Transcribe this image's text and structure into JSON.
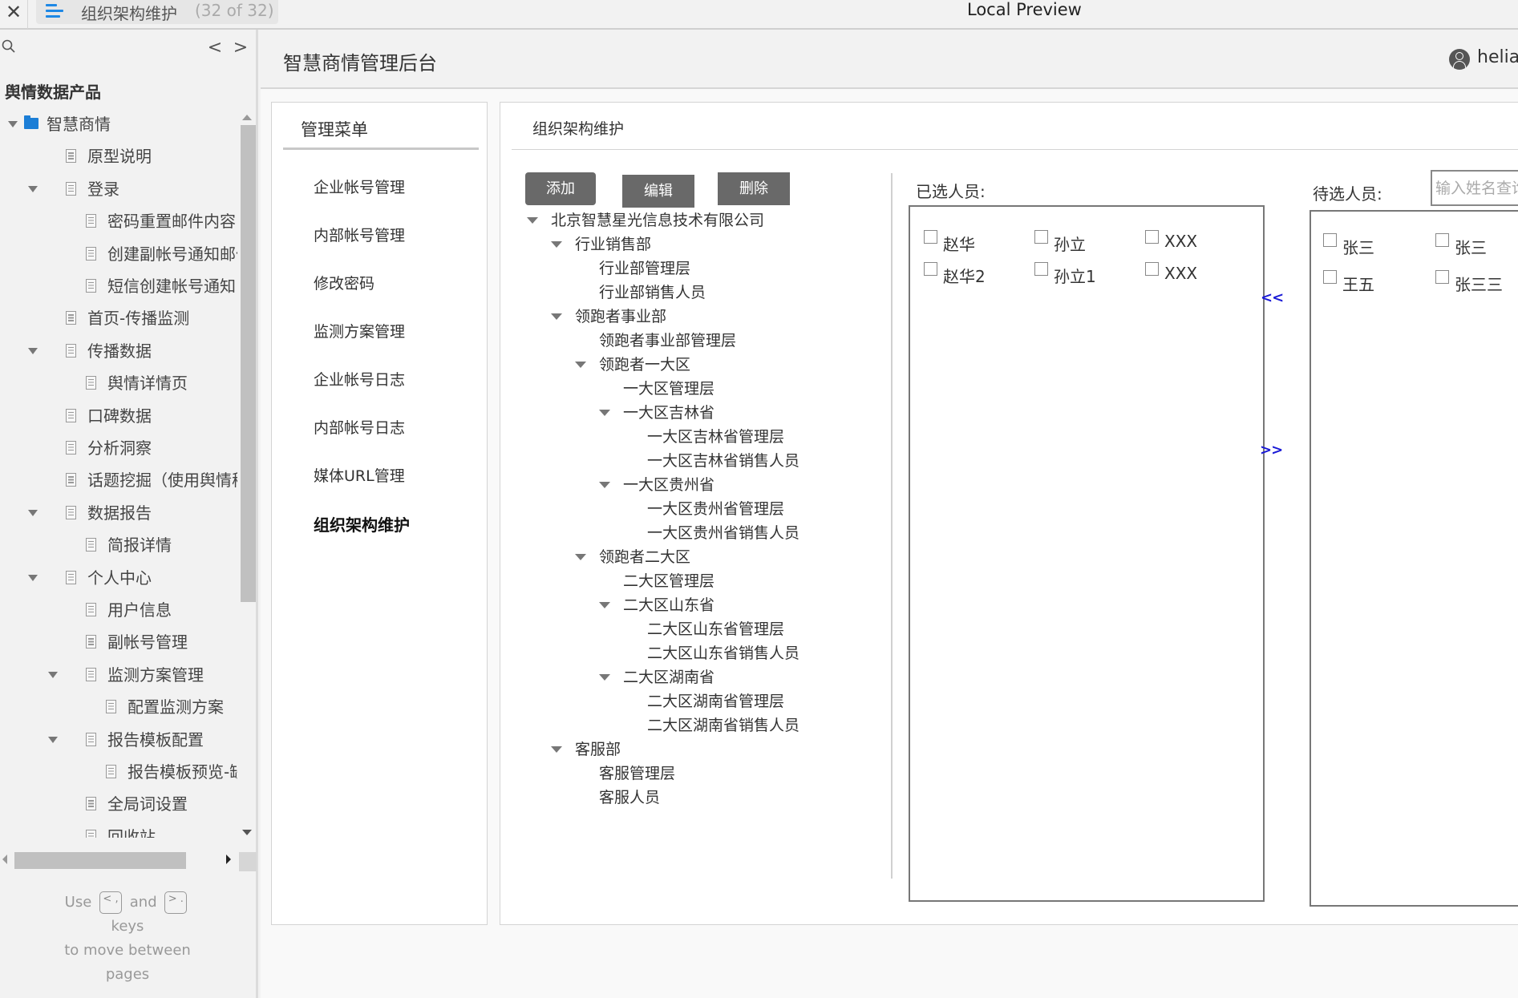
{
  "window": {
    "close_icon": "close-icon",
    "tab_title": "组织架构维护",
    "tab_count": "(32 of 32)",
    "center_title": "Local Preview"
  },
  "sidebar": {
    "search_icon": "search-icon",
    "prev_label": "<",
    "next_label": ">",
    "product_title": "舆情数据产品",
    "items": [
      {
        "label": "智慧商情",
        "level": 0,
        "type": "folder",
        "expanded": true
      },
      {
        "label": "原型说明",
        "level": 1,
        "type": "page",
        "expanded": null
      },
      {
        "label": "登录",
        "level": 1,
        "type": "page",
        "expanded": true
      },
      {
        "label": "密码重置邮件内容",
        "level": 2,
        "type": "page",
        "expanded": null
      },
      {
        "label": "创建副帐号通知邮件",
        "level": 2,
        "type": "page",
        "expanded": null
      },
      {
        "label": "短信创建帐号通知",
        "level": 2,
        "type": "page",
        "expanded": null
      },
      {
        "label": "首页-传播监测",
        "level": 1,
        "type": "page",
        "expanded": null
      },
      {
        "label": "传播数据",
        "level": 1,
        "type": "page",
        "expanded": true
      },
      {
        "label": "舆情详情页",
        "level": 2,
        "type": "page",
        "expanded": null
      },
      {
        "label": "口碑数据",
        "level": 1,
        "type": "page",
        "expanded": null
      },
      {
        "label": "分析洞察",
        "level": 1,
        "type": "page",
        "expanded": null
      },
      {
        "label": "话题挖掘（使用舆情秘书",
        "level": 1,
        "type": "page",
        "expanded": null
      },
      {
        "label": "数据报告",
        "level": 1,
        "type": "page",
        "expanded": true
      },
      {
        "label": "简报详情",
        "level": 2,
        "type": "page",
        "expanded": null
      },
      {
        "label": "个人中心",
        "level": 1,
        "type": "page",
        "expanded": true
      },
      {
        "label": "用户信息",
        "level": 2,
        "type": "page",
        "expanded": null
      },
      {
        "label": "副帐号管理",
        "level": 2,
        "type": "page",
        "expanded": null
      },
      {
        "label": "监测方案管理",
        "level": 2,
        "type": "page",
        "expanded": true
      },
      {
        "label": "配置监测方案",
        "level": 3,
        "type": "page",
        "expanded": null
      },
      {
        "label": "报告模板配置",
        "level": 2,
        "type": "page",
        "expanded": true
      },
      {
        "label": "报告模板预览-缺",
        "level": 3,
        "type": "page",
        "expanded": null
      },
      {
        "label": "全局词设置",
        "level": 2,
        "type": "page",
        "expanded": null
      },
      {
        "label": "回收站",
        "level": 2,
        "type": "page",
        "expanded": null
      }
    ],
    "hint": {
      "use": "Use",
      "key_prev": "< ,",
      "and": "and",
      "key_next": "> .",
      "keys": "keys",
      "to_move": "to move between",
      "pages": "pages"
    }
  },
  "header": {
    "app_title": "智慧商情管理后台",
    "user_icon": "user-icon",
    "username": "helian"
  },
  "menu": {
    "title": "管理菜单",
    "items": [
      {
        "label": "企业帐号管理",
        "active": false
      },
      {
        "label": "内部帐号管理",
        "active": false
      },
      {
        "label": "修改密码",
        "active": false
      },
      {
        "label": "监测方案管理",
        "active": false
      },
      {
        "label": "企业帐号日志",
        "active": false
      },
      {
        "label": "内部帐号日志",
        "active": false
      },
      {
        "label": "媒体URL管理",
        "active": false
      },
      {
        "label": "组织架构维护",
        "active": true
      }
    ]
  },
  "content": {
    "title": "组织架构维护",
    "buttons": {
      "add": "添加",
      "edit": "编辑",
      "delete": "删除"
    },
    "org_tree": [
      {
        "label": "北京智慧星光信息技术有限公司",
        "level": 0,
        "expandable": true
      },
      {
        "label": "行业销售部",
        "level": 1,
        "expandable": true
      },
      {
        "label": "行业部管理层",
        "level": 2,
        "expandable": false
      },
      {
        "label": "行业部销售人员",
        "level": 2,
        "expandable": false
      },
      {
        "label": "领跑者事业部",
        "level": 1,
        "expandable": true
      },
      {
        "label": "领跑者事业部管理层",
        "level": 2,
        "expandable": false
      },
      {
        "label": "领跑者一大区",
        "level": 2,
        "expandable": true
      },
      {
        "label": "一大区管理层",
        "level": 3,
        "expandable": false
      },
      {
        "label": "一大区吉林省",
        "level": 3,
        "expandable": true
      },
      {
        "label": "一大区吉林省管理层",
        "level": 4,
        "expandable": false
      },
      {
        "label": "一大区吉林省销售人员",
        "level": 4,
        "expandable": false
      },
      {
        "label": "一大区贵州省",
        "level": 3,
        "expandable": true
      },
      {
        "label": "一大区贵州省管理层",
        "level": 4,
        "expandable": false
      },
      {
        "label": "一大区贵州省销售人员",
        "level": 4,
        "expandable": false
      },
      {
        "label": "领跑者二大区",
        "level": 2,
        "expandable": true
      },
      {
        "label": "二大区管理层",
        "level": 3,
        "expandable": false
      },
      {
        "label": "二大区山东省",
        "level": 3,
        "expandable": true
      },
      {
        "label": "二大区山东省管理层",
        "level": 4,
        "expandable": false
      },
      {
        "label": "二大区山东省销售人员",
        "level": 4,
        "expandable": false
      },
      {
        "label": "二大区湖南省",
        "level": 3,
        "expandable": true
      },
      {
        "label": "二大区湖南省管理层",
        "level": 4,
        "expandable": false
      },
      {
        "label": "二大区湖南省销售人员",
        "level": 4,
        "expandable": false
      },
      {
        "label": "客服部",
        "level": 1,
        "expandable": true
      },
      {
        "label": "客服管理层",
        "level": 2,
        "expandable": false
      },
      {
        "label": "客服人员",
        "level": 2,
        "expandable": false
      }
    ],
    "selected": {
      "label": "已选人员:",
      "people": [
        {
          "name": "赵华",
          "checked": false
        },
        {
          "name": "孙立",
          "checked": false
        },
        {
          "name": "XXX",
          "checked": false
        },
        {
          "name": "赵华2",
          "checked": false
        },
        {
          "name": "孙立1",
          "checked": false
        },
        {
          "name": "XXX",
          "checked": false
        }
      ]
    },
    "transfer": {
      "move_left": "<<",
      "move_right": ">>"
    },
    "pending": {
      "label": "待选人员:",
      "search_placeholder": "输入姓名查询",
      "search_value": "",
      "people": [
        {
          "name": "张三",
          "checked": false
        },
        {
          "name": "张三",
          "checked": false
        },
        {
          "name": "王五",
          "checked": false
        },
        {
          "name": "张三三",
          "checked": false
        }
      ]
    }
  }
}
